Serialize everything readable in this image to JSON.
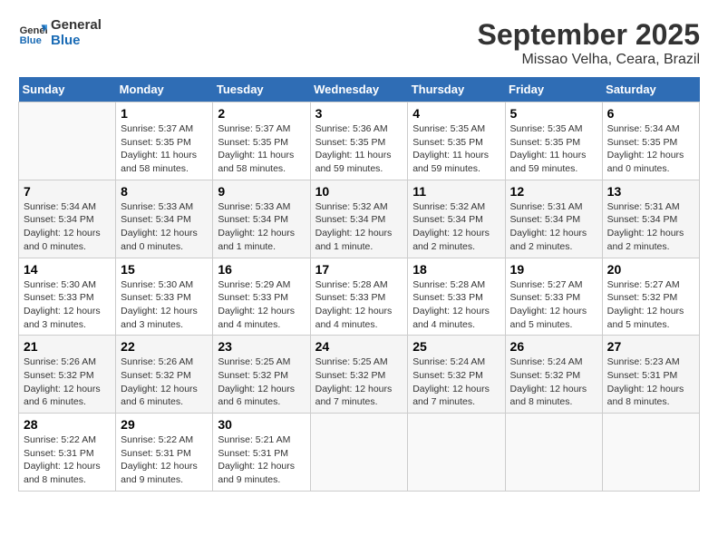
{
  "header": {
    "logo_line1": "General",
    "logo_line2": "Blue",
    "month": "September 2025",
    "location": "Missao Velha, Ceara, Brazil"
  },
  "columns": [
    "Sunday",
    "Monday",
    "Tuesday",
    "Wednesday",
    "Thursday",
    "Friday",
    "Saturday"
  ],
  "weeks": [
    [
      {
        "num": "",
        "info": ""
      },
      {
        "num": "1",
        "info": "Sunrise: 5:37 AM\nSunset: 5:35 PM\nDaylight: 11 hours\nand 58 minutes."
      },
      {
        "num": "2",
        "info": "Sunrise: 5:37 AM\nSunset: 5:35 PM\nDaylight: 11 hours\nand 58 minutes."
      },
      {
        "num": "3",
        "info": "Sunrise: 5:36 AM\nSunset: 5:35 PM\nDaylight: 11 hours\nand 59 minutes."
      },
      {
        "num": "4",
        "info": "Sunrise: 5:35 AM\nSunset: 5:35 PM\nDaylight: 11 hours\nand 59 minutes."
      },
      {
        "num": "5",
        "info": "Sunrise: 5:35 AM\nSunset: 5:35 PM\nDaylight: 11 hours\nand 59 minutes."
      },
      {
        "num": "6",
        "info": "Sunrise: 5:34 AM\nSunset: 5:35 PM\nDaylight: 12 hours\nand 0 minutes."
      }
    ],
    [
      {
        "num": "7",
        "info": "Sunrise: 5:34 AM\nSunset: 5:34 PM\nDaylight: 12 hours\nand 0 minutes."
      },
      {
        "num": "8",
        "info": "Sunrise: 5:33 AM\nSunset: 5:34 PM\nDaylight: 12 hours\nand 0 minutes."
      },
      {
        "num": "9",
        "info": "Sunrise: 5:33 AM\nSunset: 5:34 PM\nDaylight: 12 hours\nand 1 minute."
      },
      {
        "num": "10",
        "info": "Sunrise: 5:32 AM\nSunset: 5:34 PM\nDaylight: 12 hours\nand 1 minute."
      },
      {
        "num": "11",
        "info": "Sunrise: 5:32 AM\nSunset: 5:34 PM\nDaylight: 12 hours\nand 2 minutes."
      },
      {
        "num": "12",
        "info": "Sunrise: 5:31 AM\nSunset: 5:34 PM\nDaylight: 12 hours\nand 2 minutes."
      },
      {
        "num": "13",
        "info": "Sunrise: 5:31 AM\nSunset: 5:34 PM\nDaylight: 12 hours\nand 2 minutes."
      }
    ],
    [
      {
        "num": "14",
        "info": "Sunrise: 5:30 AM\nSunset: 5:33 PM\nDaylight: 12 hours\nand 3 minutes."
      },
      {
        "num": "15",
        "info": "Sunrise: 5:30 AM\nSunset: 5:33 PM\nDaylight: 12 hours\nand 3 minutes."
      },
      {
        "num": "16",
        "info": "Sunrise: 5:29 AM\nSunset: 5:33 PM\nDaylight: 12 hours\nand 4 minutes."
      },
      {
        "num": "17",
        "info": "Sunrise: 5:28 AM\nSunset: 5:33 PM\nDaylight: 12 hours\nand 4 minutes."
      },
      {
        "num": "18",
        "info": "Sunrise: 5:28 AM\nSunset: 5:33 PM\nDaylight: 12 hours\nand 4 minutes."
      },
      {
        "num": "19",
        "info": "Sunrise: 5:27 AM\nSunset: 5:33 PM\nDaylight: 12 hours\nand 5 minutes."
      },
      {
        "num": "20",
        "info": "Sunrise: 5:27 AM\nSunset: 5:32 PM\nDaylight: 12 hours\nand 5 minutes."
      }
    ],
    [
      {
        "num": "21",
        "info": "Sunrise: 5:26 AM\nSunset: 5:32 PM\nDaylight: 12 hours\nand 6 minutes."
      },
      {
        "num": "22",
        "info": "Sunrise: 5:26 AM\nSunset: 5:32 PM\nDaylight: 12 hours\nand 6 minutes."
      },
      {
        "num": "23",
        "info": "Sunrise: 5:25 AM\nSunset: 5:32 PM\nDaylight: 12 hours\nand 6 minutes."
      },
      {
        "num": "24",
        "info": "Sunrise: 5:25 AM\nSunset: 5:32 PM\nDaylight: 12 hours\nand 7 minutes."
      },
      {
        "num": "25",
        "info": "Sunrise: 5:24 AM\nSunset: 5:32 PM\nDaylight: 12 hours\nand 7 minutes."
      },
      {
        "num": "26",
        "info": "Sunrise: 5:24 AM\nSunset: 5:32 PM\nDaylight: 12 hours\nand 8 minutes."
      },
      {
        "num": "27",
        "info": "Sunrise: 5:23 AM\nSunset: 5:31 PM\nDaylight: 12 hours\nand 8 minutes."
      }
    ],
    [
      {
        "num": "28",
        "info": "Sunrise: 5:22 AM\nSunset: 5:31 PM\nDaylight: 12 hours\nand 8 minutes."
      },
      {
        "num": "29",
        "info": "Sunrise: 5:22 AM\nSunset: 5:31 PM\nDaylight: 12 hours\nand 9 minutes."
      },
      {
        "num": "30",
        "info": "Sunrise: 5:21 AM\nSunset: 5:31 PM\nDaylight: 12 hours\nand 9 minutes."
      },
      {
        "num": "",
        "info": ""
      },
      {
        "num": "",
        "info": ""
      },
      {
        "num": "",
        "info": ""
      },
      {
        "num": "",
        "info": ""
      }
    ]
  ]
}
